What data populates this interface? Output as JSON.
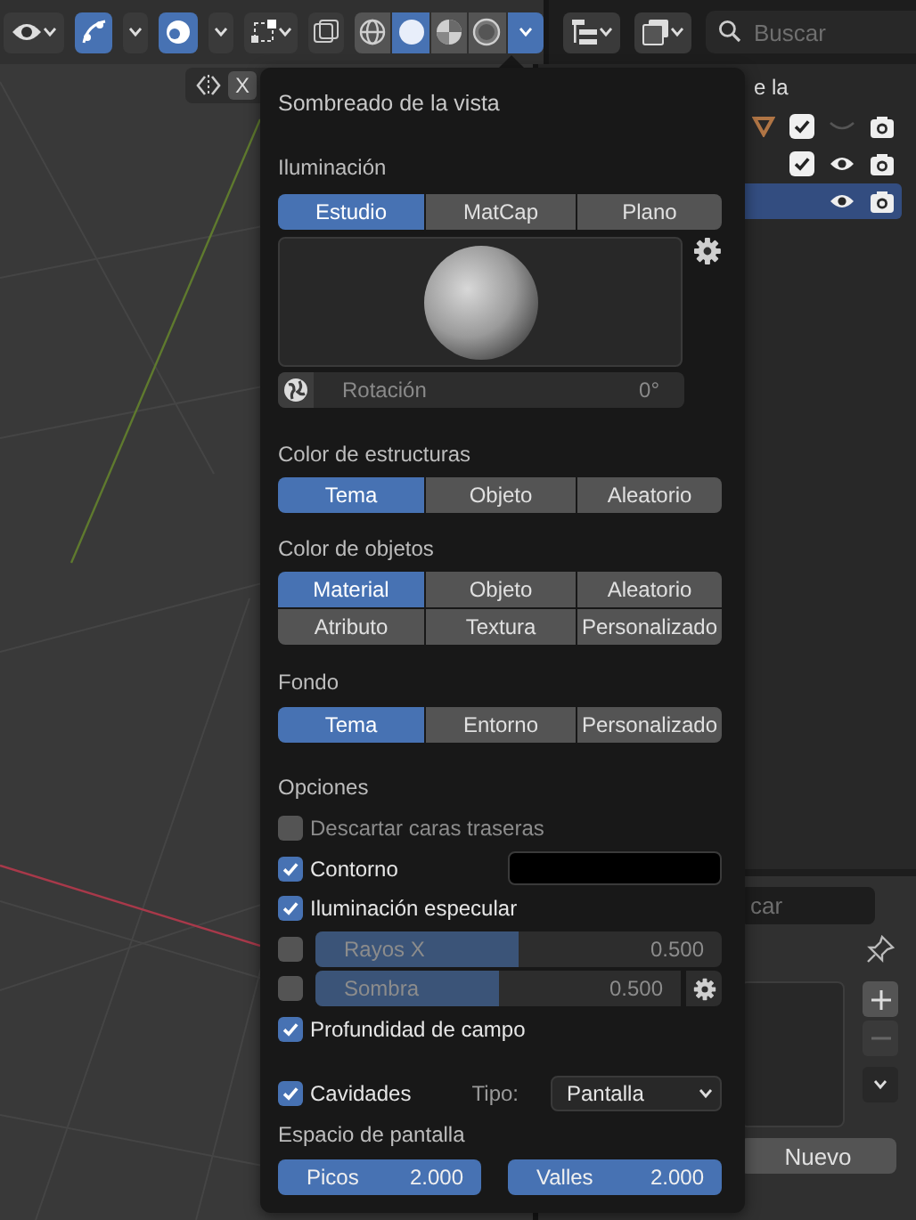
{
  "toolbar": {
    "shading_modes": [
      {
        "kind": "wireframe",
        "selected": false
      },
      {
        "kind": "solid",
        "selected": true
      },
      {
        "kind": "material",
        "selected": false
      },
      {
        "kind": "rendered",
        "selected": false
      }
    ],
    "search": {
      "placeholder": "Buscar"
    }
  },
  "viewport": {
    "axis_label": "X"
  },
  "outliner": {
    "heading": "e la",
    "rows": [
      {
        "kind": "mesh",
        "checked": true,
        "visible": false,
        "selected": false
      },
      {
        "kind": "plain",
        "checked": true,
        "visible": true,
        "selected": false
      },
      {
        "kind": "object",
        "checked": false,
        "visible": true,
        "selected": true
      }
    ]
  },
  "properties": {
    "search": {
      "placeholder": "car"
    },
    "new_button": "Nuevo"
  },
  "popover": {
    "title": "Sombreado de la vista",
    "lighting": {
      "label": "Iluminación",
      "options": [
        {
          "label": "Estudio",
          "selected": true
        },
        {
          "label": "MatCap",
          "selected": false
        },
        {
          "label": "Plano",
          "selected": false
        }
      ],
      "rotation": {
        "label": "Rotación",
        "value": "0°",
        "level": 0
      }
    },
    "wire_color": {
      "label": "Color de estructuras",
      "options": [
        {
          "label": "Tema",
          "selected": true
        },
        {
          "label": "Objeto",
          "selected": false
        },
        {
          "label": "Aleatorio",
          "selected": false
        }
      ]
    },
    "object_color": {
      "label": "Color de objetos",
      "options": [
        {
          "label": "Material",
          "selected": true
        },
        {
          "label": "Objeto",
          "selected": false
        },
        {
          "label": "Aleatorio",
          "selected": false
        },
        {
          "label": "Atributo",
          "selected": false
        },
        {
          "label": "Textura",
          "selected": false
        },
        {
          "label": "Personalizado",
          "selected": false
        }
      ]
    },
    "background": {
      "label": "Fondo",
      "options": [
        {
          "label": "Tema",
          "selected": true
        },
        {
          "label": "Entorno",
          "selected": false
        },
        {
          "label": "Personalizado",
          "selected": false
        }
      ]
    },
    "options": {
      "label": "Opciones",
      "items": [
        {
          "kind": "checkbox",
          "label": "Descartar caras traseras",
          "checked": false
        },
        {
          "kind": "color",
          "label": "Contorno",
          "checked": true,
          "color": "#000000"
        },
        {
          "kind": "checkbox",
          "label": "Iluminación especular",
          "checked": true
        },
        {
          "kind": "slider",
          "label": "Rayos X",
          "checked": false,
          "level": 0.5,
          "reading": "0.500"
        },
        {
          "kind": "slider_gear",
          "label": "Sombra",
          "checked": false,
          "level": 0.5,
          "reading": "0.500"
        },
        {
          "kind": "checkbox",
          "label": "Profundidad de campo",
          "checked": true
        }
      ]
    },
    "cavity": {
      "label": "Cavidades",
      "checked": true,
      "type_label": "Tipo:",
      "type_value": "Pantalla",
      "space_label": "Espacio de pantalla",
      "fields": [
        {
          "label": "Picos",
          "value": "2.000"
        },
        {
          "label": "Valles",
          "value": "2.000"
        }
      ]
    }
  }
}
